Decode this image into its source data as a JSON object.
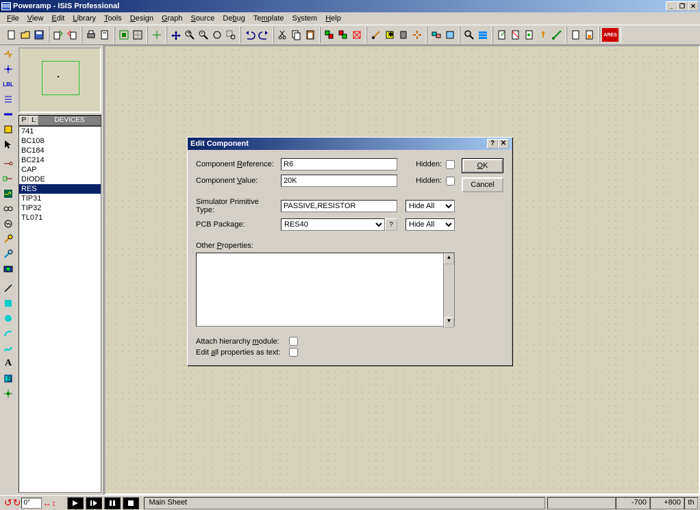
{
  "title": "Poweramp - ISIS Professional",
  "app_icon_text": "ISIS",
  "menu": [
    "File",
    "View",
    "Edit",
    "Library",
    "Tools",
    "Design",
    "Graph",
    "Source",
    "Debug",
    "Template",
    "System",
    "Help"
  ],
  "devices_header": "DEVICES",
  "pl_p": "P",
  "pl_l": "L",
  "devices": [
    "741",
    "BC108",
    "BC184",
    "BC214",
    "CAP",
    "DIODE",
    "RES",
    "TIP31",
    "TIP32",
    "TL071"
  ],
  "selected_device_index": 6,
  "dialog": {
    "title": "Edit Component",
    "ref_label": "Component Reference:",
    "ref_value": "R6",
    "val_label": "Component Value:",
    "val_value": "20K",
    "hidden_label": "Hidden:",
    "sim_label": "Simulator Primitive Type:",
    "sim_value": "PASSIVE,RESISTOR",
    "pcb_label": "PCB Package:",
    "pcb_value": "RES40",
    "hide_all": "Hide All",
    "other_label": "Other Properties:",
    "attach_label": "Attach hierarchy module:",
    "editall_label": "Edit all properties as text:",
    "ok": "OK",
    "cancel": "Cancel",
    "help": "?"
  },
  "rotation_input": "0°",
  "status_main": "Main Sheet",
  "coord_x": "-700",
  "coord_y": "+800",
  "unit": "th"
}
